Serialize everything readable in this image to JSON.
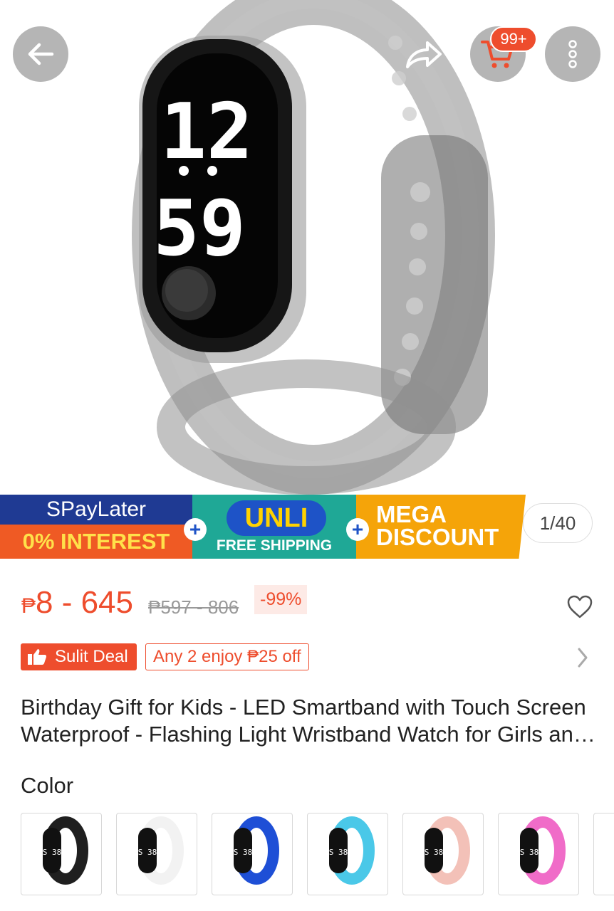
{
  "header": {
    "back_icon": "arrow-left-icon",
    "share_icon": "share-icon",
    "cart_icon": "cart-icon",
    "cart_badge": "99+",
    "more_icon": "more-vertical-icon"
  },
  "hero": {
    "watch_display_top": "12",
    "watch_display_bottom": "59",
    "image_counter": "1/40"
  },
  "promo_banner": {
    "paylater_title": "SPayLater",
    "paylater_sub": "0% INTEREST",
    "unli_title": "UNLI",
    "unli_sub": "FREE SHIPPING",
    "mega_line1": "MEGA",
    "mega_line2": "DISCOUNT",
    "plus_sign": "+"
  },
  "pricing": {
    "currency": "₱",
    "price_range": "8 - 645",
    "original_price": "₱597 - 806",
    "discount": "-99%"
  },
  "deal": {
    "badge_label": "Sulit Deal",
    "voucher_text": "Any 2 enjoy ₱25 off"
  },
  "product": {
    "title": "Birthday Gift for Kids - LED Smartband with Touch Screen Waterproof - Flashing Light Wristband Watch for Girls and Boys"
  },
  "variants": {
    "label": "Color",
    "options": [
      {
        "color": "#1f1f1f",
        "screen": "S 38"
      },
      {
        "color": "#f2f2f2",
        "screen": "S 38"
      },
      {
        "color": "#1e4fd6",
        "screen": "S 38"
      },
      {
        "color": "#4ac8e8",
        "screen": "S 38"
      },
      {
        "color": "#f3c1b8",
        "screen": "S 38"
      },
      {
        "color": "#f06cc8",
        "screen": "S 38"
      }
    ]
  },
  "colors": {
    "accent": "#ee4d2d",
    "paylater_blue": "#1f3a93",
    "unli_teal": "#1fa896",
    "mega_orange": "#f5a409"
  }
}
